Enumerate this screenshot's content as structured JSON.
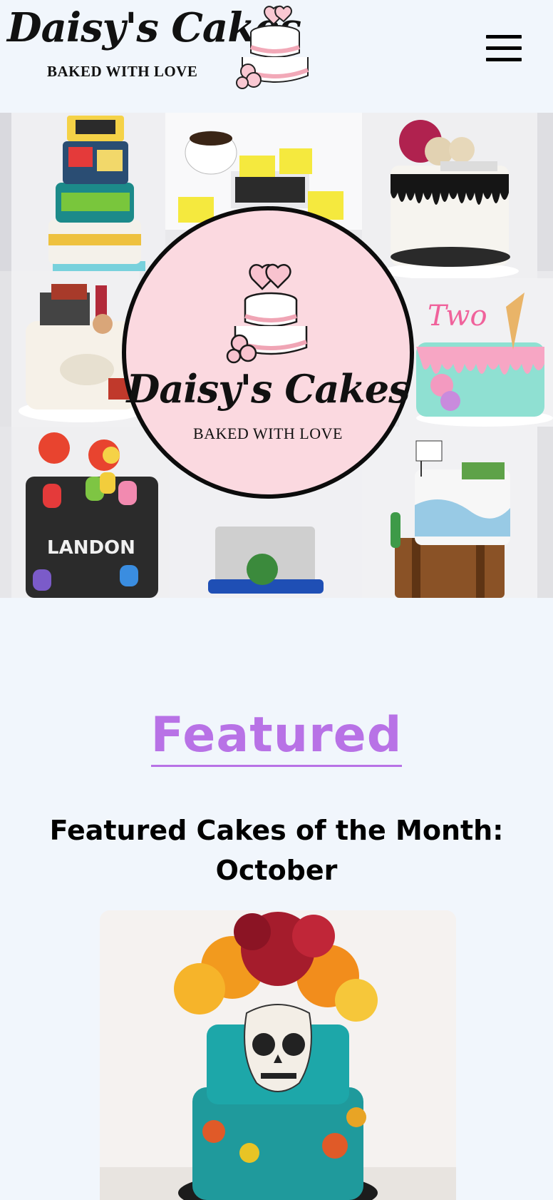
{
  "header": {
    "logo_name": "Daisy's Cakes",
    "logo_tagline": "BAKED WITH LOVE",
    "menu_icon": "hamburger-menu-icon"
  },
  "hero": {
    "badge_name": "Daisy's Cakes",
    "badge_tagline": "BAKED WITH LOVE"
  },
  "featured": {
    "title": "Featured",
    "heading": "Featured Cakes of the Month: October"
  },
  "colors": {
    "page_bg": "#f1f6fc",
    "accent": "#b872e6",
    "badge_bg": "#fbd9e0"
  }
}
